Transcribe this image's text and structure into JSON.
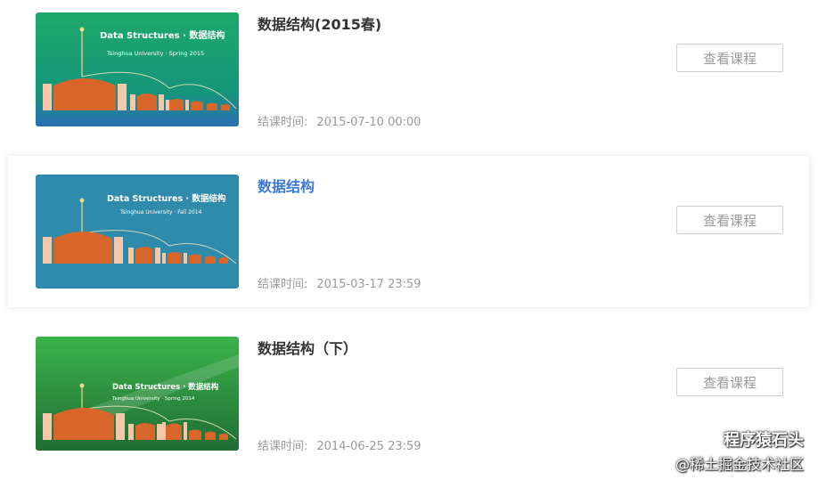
{
  "courses": [
    {
      "title": "数据结构(2015春)",
      "end_label": "结课时间:",
      "end_time": "2015-07-10 00:00",
      "button_label": "查看课程",
      "cover": {
        "heading": "Data Structures · 数据结构",
        "subtitle": "Tsinghua University · Spring 2015",
        "bg_top": "#1fa86a",
        "bg_bottom": "#2a6fb5"
      }
    },
    {
      "title": "数据结构",
      "end_label": "结课时间:",
      "end_time": "2015-03-17 23:59",
      "button_label": "查看课程",
      "cover": {
        "heading": "Data Structures · 数据结构",
        "subtitle": "Tsinghua University · Fall 2014",
        "bg_top": "#2f8bab",
        "bg_bottom": "#3a86a8"
      }
    },
    {
      "title": "数据结构（下）",
      "end_label": "结课时间:",
      "end_time": "2014-06-25 23:59",
      "button_label": "查看课程",
      "cover": {
        "heading": "Data Structures · 数据结构",
        "subtitle": "Tsinghua University · Spring 2014",
        "bg_top": "#3bb34a",
        "bg_bottom": "#1f6d34"
      }
    }
  ],
  "watermark": {
    "line1": "程序猿石头",
    "line2": "@稀土掘金技术社区"
  },
  "colors": {
    "title_active": "#3b78d8",
    "title_default": "#333333",
    "muted_text": "#9a9a9a",
    "button_border": "#cfcfcf",
    "building": "#d8662a",
    "pillar": "#f4c8a8"
  }
}
